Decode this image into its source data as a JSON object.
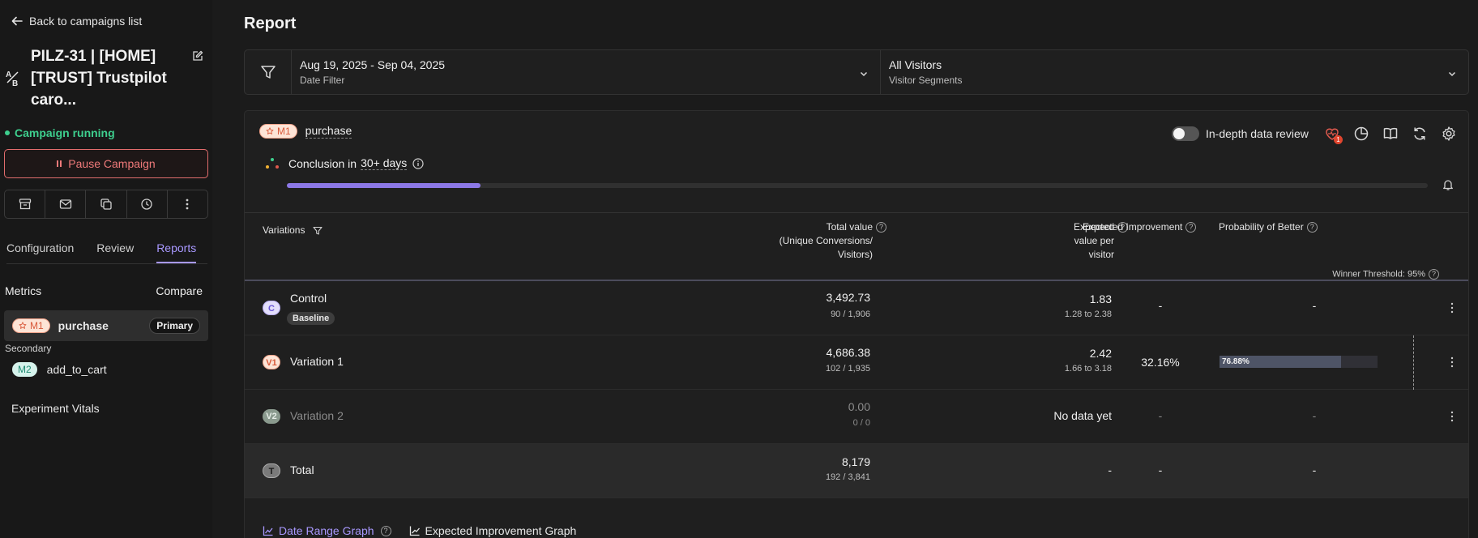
{
  "sidebar": {
    "back_label": "Back to campaigns list",
    "campaign_title": "PILZ-31 | [HOME] [TRUST] Trustpilot caro...",
    "status": "Campaign running",
    "pause_label": "Pause Campaign",
    "action_icons": [
      "archive-icon",
      "mail-icon",
      "copy-icon",
      "history-icon",
      "more-vertical-icon"
    ],
    "tabs": [
      {
        "label": "Configuration",
        "active": false
      },
      {
        "label": "Review",
        "active": false
      },
      {
        "label": "Reports",
        "active": true
      }
    ],
    "metrics_label": "Metrics",
    "compare_label": "Compare",
    "primary_metric": {
      "badge": "M1",
      "name": "purchase",
      "pill": "Primary"
    },
    "secondary_label": "Secondary",
    "secondary_metric": {
      "badge": "M2",
      "name": "add_to_cart"
    },
    "vitals_label": "Experiment Vitals"
  },
  "report": {
    "title": "Report",
    "date_filter": {
      "value": "Aug 19, 2025 - Sep 04, 2025",
      "label": "Date Filter"
    },
    "segment_filter": {
      "value": "All Visitors",
      "label": "Visitor Segments"
    },
    "metric": {
      "badge": "M1",
      "name": "purchase"
    },
    "toggle_label": "In-depth data review",
    "toggle_on": false,
    "notification_count": "1",
    "conclusion_prefix": "Conclusion in",
    "conclusion_days": "30+ days",
    "progress": 0.17,
    "columns": {
      "variations": "Variations",
      "total_value": [
        "Total value",
        "(Unique Conversions/",
        "Visitors)"
      ],
      "expected_value": [
        "Expected",
        "value per",
        "visitor"
      ],
      "expected_improvement": "Expected Improvement",
      "probability": "Probability of Better"
    },
    "winner_threshold": "Winner Threshold: 95%",
    "rows": [
      {
        "badge": "C",
        "name": "Control",
        "baseline": "Baseline",
        "total": "3,492.73",
        "ratio": "90 / 1,906",
        "evpv": "1.83",
        "range": "1.28 to 2.38",
        "improvement": "-",
        "probability": "-"
      },
      {
        "badge": "V1",
        "name": "Variation 1",
        "total": "4,686.38",
        "ratio": "102 / 1,935",
        "evpv": "2.42",
        "range": "1.66 to 3.18",
        "improvement": "32.16%",
        "probability": "76.88%",
        "probability_value": 0.7688
      },
      {
        "badge": "V2",
        "name": "Variation 2",
        "total": "0.00",
        "ratio": "0 / 0",
        "evpv": "No data yet",
        "improvement": "-",
        "probability": "-"
      },
      {
        "badge": "T",
        "name": "Total",
        "total": "8,179",
        "ratio": "192 / 3,841",
        "evpv": "-",
        "improvement": "-",
        "probability": "-"
      }
    ],
    "graph_links": [
      {
        "label": "Date Range Graph",
        "active": true
      },
      {
        "label": "Expected Improvement Graph",
        "active": false
      }
    ]
  }
}
